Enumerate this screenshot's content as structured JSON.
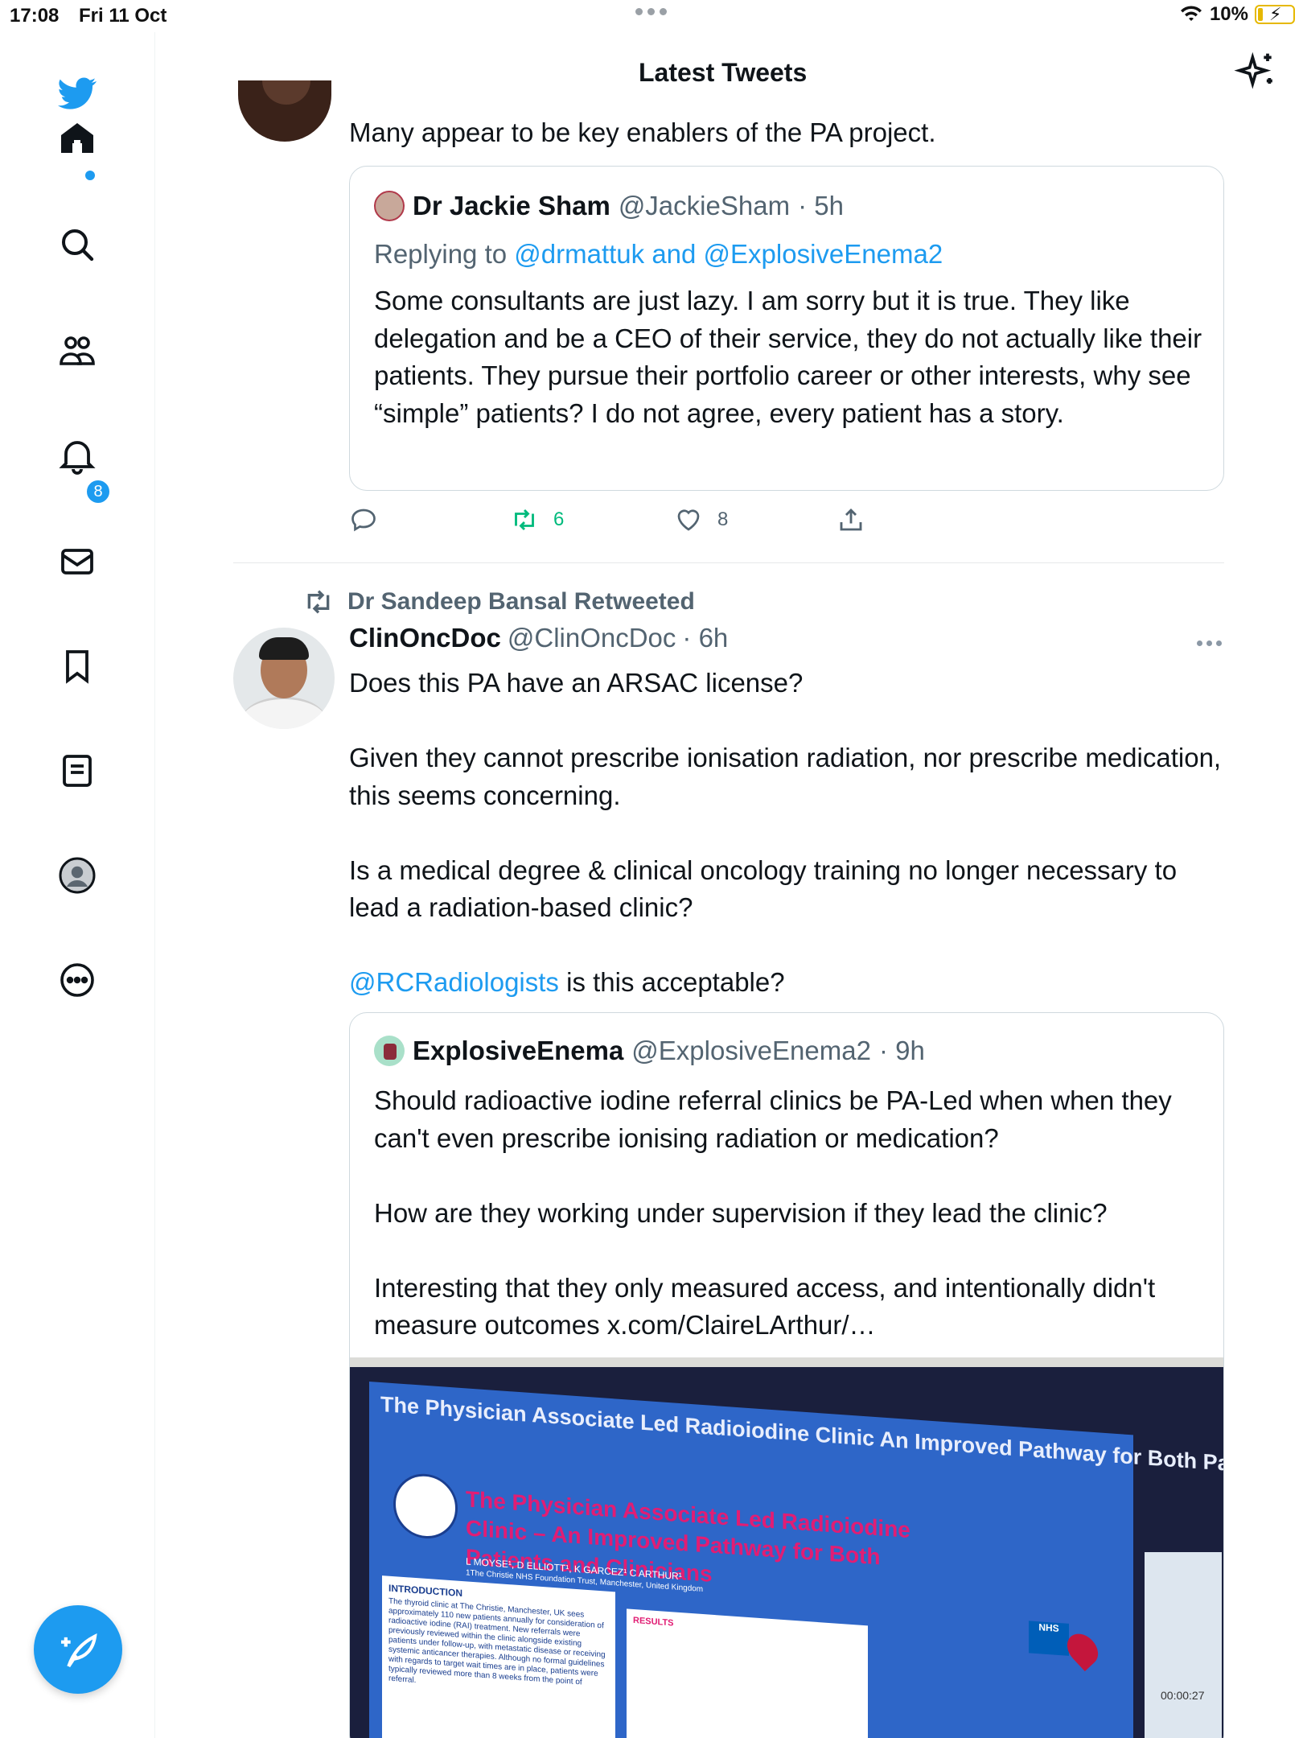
{
  "status_bar": {
    "time": "17:08",
    "date": "Fri 11 Oct",
    "battery_percent": "10%"
  },
  "sidebar": {
    "items": [
      {
        "name": "home",
        "icon": "home-icon"
      },
      {
        "name": "search",
        "icon": "search-icon"
      },
      {
        "name": "communities",
        "icon": "people-icon"
      },
      {
        "name": "notifications",
        "icon": "bell-icon",
        "badge": "8"
      },
      {
        "name": "messages",
        "icon": "mail-icon"
      },
      {
        "name": "bookmarks",
        "icon": "bookmark-icon"
      },
      {
        "name": "lists",
        "icon": "list-icon"
      },
      {
        "name": "profile",
        "icon": "profile-icon"
      },
      {
        "name": "more",
        "icon": "more-icon"
      }
    ],
    "compose_icon": "compose-icon"
  },
  "header": {
    "title": "Latest Tweets",
    "sparkle_icon": "sparkle-icon"
  },
  "tweet1": {
    "text": "Many appear to be key enablers of the PA project.",
    "quote": {
      "name": "Dr Jackie Sham",
      "handle": "@JackieSham",
      "time": "· 5h",
      "replying_prefix": "Replying to",
      "replying_to": "@drmattuk and @ExplosiveEnema2",
      "body": "Some consultants are just lazy. I am sorry but it is true. They like delegation and be a CEO of their service, they do not actually like their patients. They pursue their portfolio career or other interests, why see “simple” patients? I do not agree, every patient has a story."
    },
    "actions": {
      "reply_count": "",
      "retweet_count": "6",
      "like_count": "8"
    }
  },
  "tweet2": {
    "retweeted_by": "Dr Sandeep Bansal Retweeted",
    "name": "ClinOncDoc",
    "handle": "@ClinOncDoc",
    "time": "· 6h",
    "paragraphs": [
      "Does this PA have an ARSAC license?",
      "",
      "Given they cannot prescribe ionisation radiation, nor prescribe medication, this seems concerning.",
      "",
      "Is a medical degree & clinical oncology training no longer necessary to lead a radiation-based clinic?",
      ""
    ],
    "mention": "@RCRadiologists",
    "mention_rest": " is this acceptable?",
    "quote": {
      "name": "ExplosiveEnema",
      "handle": "@ExplosiveEnema2",
      "time": "· 9h",
      "paragraphs": [
        "Should radioactive iodine referral clinics be PA-Led when when they can't even prescribe ionising radiation or medication?",
        "",
        "How are they working under supervision if they lead the clinic?",
        "",
        "Interesting that they only measured access, and intentionally didn't measure outcomes x.com/ClaireLArthur/…"
      ],
      "media": {
        "poster_title": "The Physician Associate Led Radioiodine Clinic  An Improved Pathway for Both Patients and Clinicians",
        "poster_heading": "The Physician Associate Led Radioiodine Clinic – An Improved Pathway for Both Patients and Clinicians",
        "authors": "L MOYSE¹, D ELLIOTT¹, K GARCEZ¹ C ARTHUR¹",
        "institution": "1The Christie NHS Foundation Trust, Manchester, United Kingdom",
        "intro_heading": "INTRODUCTION",
        "intro_text": "The thyroid clinic at The Christie, Manchester, UK sees approximately 110 new patients annually for consideration of radioactive iodine (RAI) treatment. New referrals were previously reviewed within the clinic alongside existing patients under follow-up, with metastatic disease or receiving systemic anticancer therapies. Although no formal guidelines with regards to target wait times are in place, patients were typically reviewed more than 8 weeks from the point of referral.",
        "results_heading": "RESULTS",
        "nhs_label": "NHS",
        "timer": "00:00:27"
      }
    }
  }
}
